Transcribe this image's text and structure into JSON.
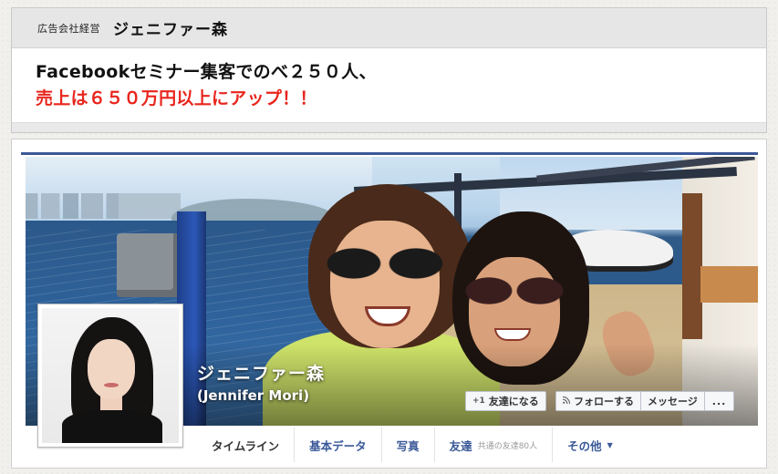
{
  "banner": {
    "company_label": "広告会社経営",
    "name": "ジェニファー森",
    "headline_line1": "Facebookセミナー集客でのべ２５０人、",
    "headline_line2": "売上は６５０万円以上にアップ！！"
  },
  "profile": {
    "name_ja": "ジェニファー森",
    "name_en": "(Jennifer Mori)"
  },
  "actions": {
    "add_friend": "友達になる",
    "add_friend_icon": "+1",
    "follow": "フォローする",
    "follow_icon": "rss-icon",
    "message": "メッセージ",
    "more": "..."
  },
  "tabs": {
    "timeline": "タイムライン",
    "about": "基本データ",
    "photos": "写真",
    "friends": "友達",
    "friends_sub": "共通の友達80人",
    "more": "その他"
  },
  "colors": {
    "facebook_blue": "#3b5998",
    "headline_red": "#e8251d"
  }
}
